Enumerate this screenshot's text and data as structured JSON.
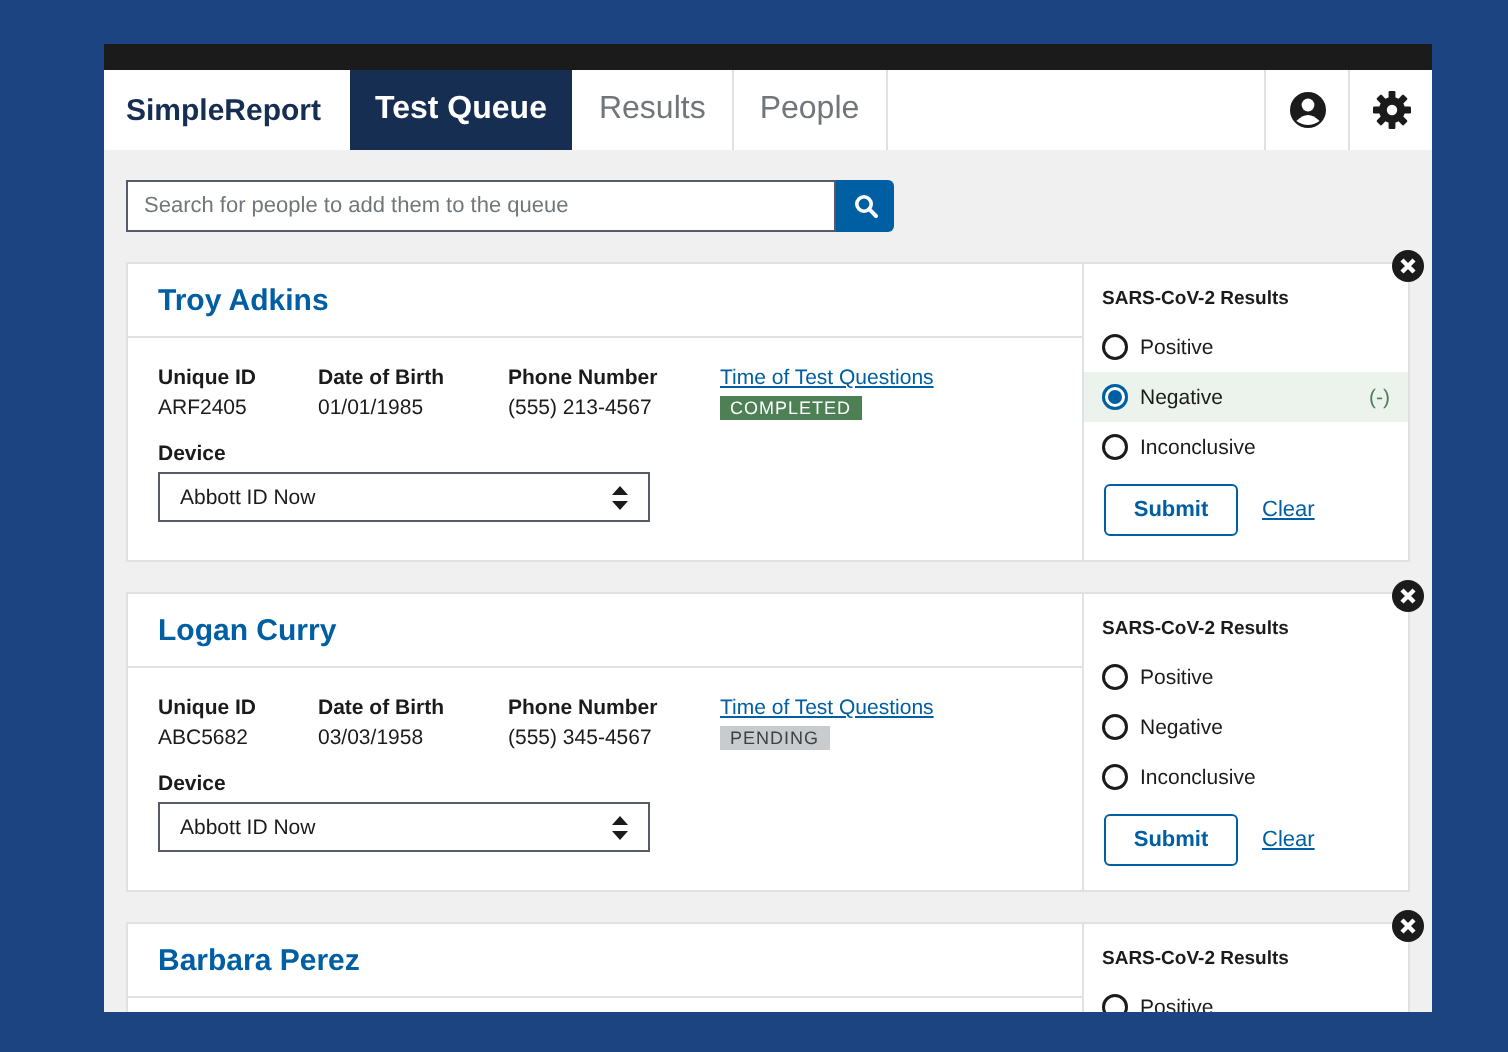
{
  "header": {
    "brand": "SimpleReport",
    "tabs": [
      {
        "label": "Test Queue",
        "selected": true
      },
      {
        "label": "Results",
        "selected": false
      },
      {
        "label": "People",
        "selected": false
      }
    ]
  },
  "search": {
    "placeholder": "Search for people to add them to the queue"
  },
  "queue": [
    {
      "name": "Troy Adkins",
      "fields": [
        {
          "label": "Unique ID",
          "value": "ARF2405"
        },
        {
          "label": "Date of Birth",
          "value": "01/01/1985"
        },
        {
          "label": "Phone Number",
          "value": "(555) 213-4567"
        }
      ],
      "questions_link": "Time of Test Questions",
      "status": {
        "label": "COMPLETED",
        "kind": "completed"
      },
      "device": {
        "label": "Device",
        "value": "Abbott ID Now"
      },
      "results": {
        "title": "SARS-CoV-2 Results",
        "options": [
          {
            "label": "Positive",
            "selected": false
          },
          {
            "label": "Negative",
            "selected": true,
            "indicator": "(-)"
          },
          {
            "label": "Inconclusive",
            "selected": false
          }
        ],
        "submit": "Submit",
        "clear": "Clear"
      }
    },
    {
      "name": "Logan Curry",
      "fields": [
        {
          "label": "Unique ID",
          "value": "ABC5682"
        },
        {
          "label": "Date of Birth",
          "value": "03/03/1958"
        },
        {
          "label": "Phone Number",
          "value": "(555) 345-4567"
        }
      ],
      "questions_link": "Time of Test Questions",
      "status": {
        "label": "PENDING",
        "kind": "pending"
      },
      "device": {
        "label": "Device",
        "value": "Abbott ID Now"
      },
      "results": {
        "title": "SARS-CoV-2 Results",
        "options": [
          {
            "label": "Positive",
            "selected": false
          },
          {
            "label": "Negative",
            "selected": false
          },
          {
            "label": "Inconclusive",
            "selected": false
          }
        ],
        "submit": "Submit",
        "clear": "Clear"
      }
    },
    {
      "name": "Barbara Perez",
      "results": {
        "title": "SARS-CoV-2 Results",
        "options": [
          {
            "label": "Positive",
            "selected": false
          }
        ]
      }
    }
  ]
}
